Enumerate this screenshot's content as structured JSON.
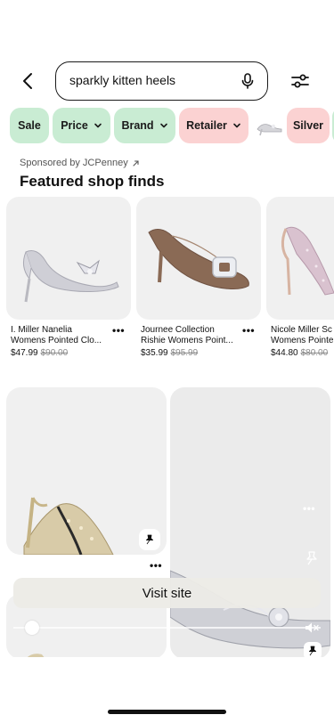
{
  "search": {
    "query": "sparkly kitten heels"
  },
  "chips": [
    {
      "label": "Sale"
    },
    {
      "label": "Price"
    },
    {
      "label": "Brand"
    },
    {
      "label": "Retailer"
    },
    {
      "label": "Silver"
    }
  ],
  "sponsored": {
    "text": "Sponsored by JCPenney"
  },
  "featured": {
    "title": "Featured shop finds"
  },
  "products": [
    {
      "name_line1": "I. Miller Nanelia",
      "name_line2": "Womens Pointed Clo...",
      "price": "$47.99",
      "old_price": "$90.00"
    },
    {
      "name_line1": "Journee Collection",
      "name_line2": "Rishie Womens Point...",
      "price": "$35.99",
      "old_price": "$95.99"
    },
    {
      "name_line1": "Nicole Miller Sc",
      "name_line2": "Womens Pointe",
      "price": "$44.80",
      "old_price": "$80.00"
    }
  ],
  "overlay": {
    "visit_label": "Visit site",
    "video_progress": 0.06
  },
  "colors": {
    "chip_green": "#c9ecd3",
    "chip_pink": "#fbd2d2",
    "text_primary": "#111111",
    "text_muted": "#8a8a8a"
  }
}
